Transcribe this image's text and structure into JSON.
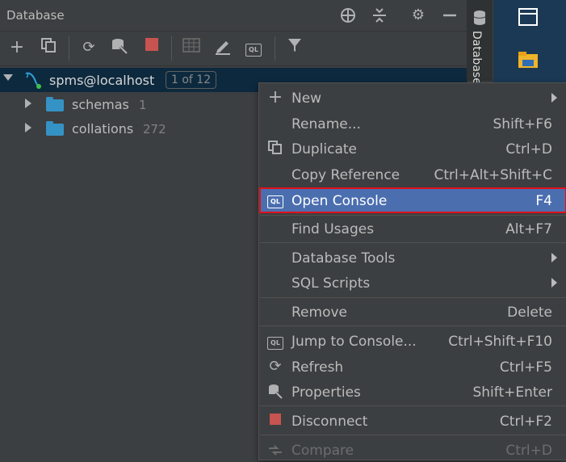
{
  "panel": {
    "title": "Database",
    "side_tab_label": "Database"
  },
  "tree": {
    "root": {
      "label": "spms@localhost",
      "badge": "1 of 12"
    },
    "children": [
      {
        "label": "schemas",
        "count": "1"
      },
      {
        "label": "collations",
        "count": "272"
      }
    ]
  },
  "menu": {
    "items": [
      {
        "label": "New",
        "shortcut": "",
        "icon": "plus-icon",
        "submenu": true
      },
      {
        "label": "Rename...",
        "shortcut": "Shift+F6",
        "icon": ""
      },
      {
        "label": "Duplicate",
        "shortcut": "Ctrl+D",
        "icon": "duplicate-icon"
      },
      {
        "label": "Copy Reference",
        "shortcut": "Ctrl+Alt+Shift+C",
        "icon": ""
      },
      {
        "label": "Open Console",
        "shortcut": "F4",
        "icon": "console-icon",
        "selected": true
      },
      {
        "label": "Find Usages",
        "shortcut": "Alt+F7",
        "icon": ""
      },
      {
        "label": "Database Tools",
        "shortcut": "",
        "icon": "",
        "submenu": true
      },
      {
        "label": "SQL Scripts",
        "shortcut": "",
        "icon": "",
        "submenu": true
      },
      {
        "label": "Remove",
        "shortcut": "Delete",
        "icon": ""
      },
      {
        "label": "Jump to Console...",
        "shortcut": "Ctrl+Shift+F10",
        "icon": "console-icon"
      },
      {
        "label": "Refresh",
        "shortcut": "Ctrl+F5",
        "icon": "refresh-icon"
      },
      {
        "label": "Properties",
        "shortcut": "Shift+Enter",
        "icon": "properties-icon"
      },
      {
        "label": "Disconnect",
        "shortcut": "Ctrl+F2",
        "icon": "stop-icon"
      },
      {
        "label": "Compare",
        "shortcut": "Ctrl+D",
        "icon": "compare-icon",
        "disabled": true
      }
    ]
  },
  "colors": {
    "selection": "#4b6eaf",
    "highlight_border": "#e0101a",
    "stop_red": "#c75450",
    "folder_blue": "#3592c4"
  }
}
